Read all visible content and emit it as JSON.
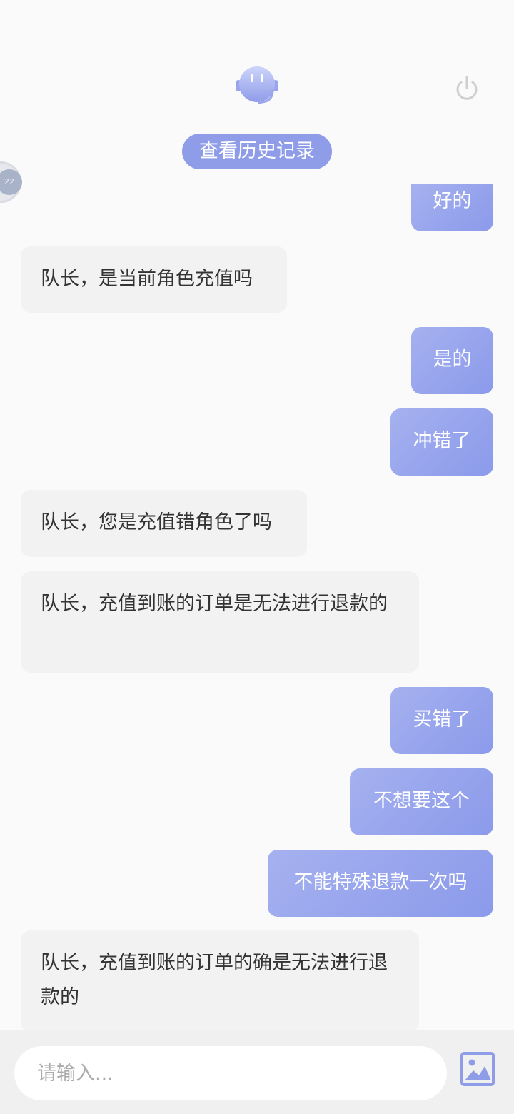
{
  "header": {
    "bot_avatar_icon": "robot-headset-icon",
    "power_icon": "power-icon",
    "history_label": "查看历史记录",
    "side_badge_text": "22"
  },
  "messages": [
    {
      "side": "out",
      "text": "好的"
    },
    {
      "side": "in",
      "text": "队长，是当前角色充值吗"
    },
    {
      "side": "out",
      "text": "是的"
    },
    {
      "side": "out",
      "text": "冲错了"
    },
    {
      "side": "in",
      "text": "队长，您是充值错角色了吗"
    },
    {
      "side": "in",
      "text": "队长，充值到账的订单是无法进行退款的"
    },
    {
      "side": "out",
      "text": "买错了"
    },
    {
      "side": "out",
      "text": "不想要这个"
    },
    {
      "side": "out",
      "text": "不能特殊退款一次吗"
    },
    {
      "side": "in",
      "text": "队长，充值到账的订单的确是无法进行退款的"
    }
  ],
  "input": {
    "placeholder": "请输入...",
    "value": "",
    "image_icon": "image-upload-icon"
  },
  "colors": {
    "accent": "#8f9ce8",
    "incoming_bubble": "#f2f2f2",
    "background": "#fafafa"
  }
}
